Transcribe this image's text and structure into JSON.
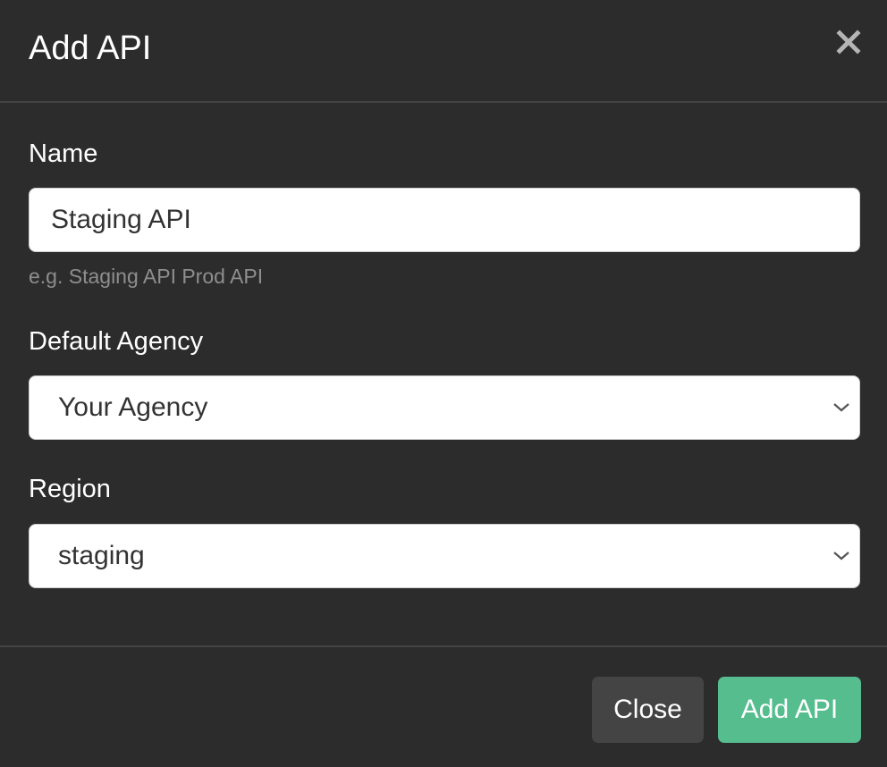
{
  "dialog": {
    "title": "Add API",
    "close_icon": "close-icon"
  },
  "form": {
    "name": {
      "label": "Name",
      "value": "Staging API",
      "hint": "e.g. Staging API Prod API"
    },
    "default_agency": {
      "label": "Default Agency",
      "selected": "Your Agency",
      "icon": "chevron-down-icon"
    },
    "region": {
      "label": "Region",
      "selected": "staging",
      "icon": "chevron-down-icon"
    }
  },
  "footer": {
    "close_label": "Close",
    "submit_label": "Add API"
  },
  "colors": {
    "background": "#2c2c2c",
    "divider": "#444444",
    "close_button": "#444444",
    "primary_button": "#56bd8f",
    "hint_text": "#8e8e8e"
  }
}
